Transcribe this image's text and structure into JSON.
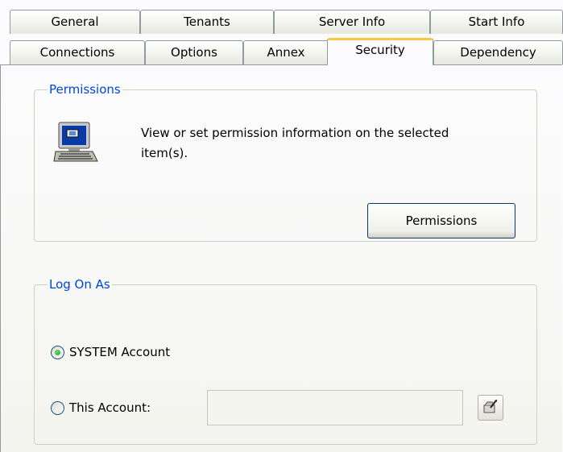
{
  "tabs_row1": [
    {
      "label": "General"
    },
    {
      "label": "Tenants"
    },
    {
      "label": "Server Info"
    },
    {
      "label": "Start Info"
    }
  ],
  "tabs_row2": [
    {
      "label": "Connections"
    },
    {
      "label": "Options"
    },
    {
      "label": "Annex"
    },
    {
      "label": "Security",
      "active": true
    },
    {
      "label": "Dependency"
    }
  ],
  "permissions": {
    "legend": "Permissions",
    "description": "View or set permission information on the selected item(s).",
    "button_label": "Permissions"
  },
  "logon": {
    "legend": "Log On As",
    "system_account_label": "SYSTEM Account",
    "this_account_label": "This Account:",
    "selected": "SYSTEM Account",
    "account_value": ""
  },
  "colors": {
    "legend_text": "#0046d5",
    "active_tab_accent": "#ffc83c",
    "radio_dot": "#21a121"
  },
  "icons": {
    "permissions_icon": "computer-icon",
    "browse_icon": "browse-account-icon"
  }
}
